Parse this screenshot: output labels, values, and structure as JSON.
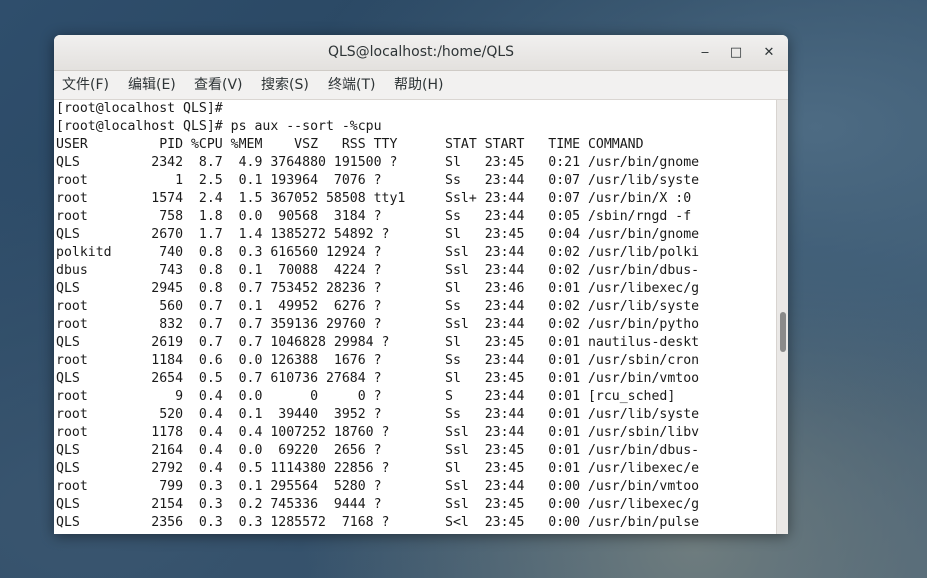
{
  "window": {
    "title": "QLS@localhost:/home/QLS",
    "controls": {
      "minimize": "‒",
      "maximize": "□",
      "close": "✕"
    }
  },
  "menu": [
    {
      "label": "文件(F)"
    },
    {
      "label": "编辑(E)"
    },
    {
      "label": "查看(V)"
    },
    {
      "label": "搜索(S)"
    },
    {
      "label": "终端(T)"
    },
    {
      "label": "帮助(H)"
    }
  ],
  "terminal": {
    "lines": [
      "[root@localhost QLS]#",
      "[root@localhost QLS]# ps aux --sort -%cpu",
      "USER         PID %CPU %MEM    VSZ   RSS TTY      STAT START   TIME COMMAND",
      "QLS         2342  8.7  4.9 3764880 191500 ?      Sl   23:45   0:21 /usr/bin/gnome",
      "root           1  2.5  0.1 193964  7076 ?        Ss   23:44   0:07 /usr/lib/syste",
      "root        1574  2.4  1.5 367052 58508 tty1     Ssl+ 23:44   0:07 /usr/bin/X :0",
      "root         758  1.8  0.0  90568  3184 ?        Ss   23:44   0:05 /sbin/rngd -f",
      "QLS         2670  1.7  1.4 1385272 54892 ?       Sl   23:45   0:04 /usr/bin/gnome",
      "polkitd      740  0.8  0.3 616560 12924 ?        Ssl  23:44   0:02 /usr/lib/polki",
      "dbus         743  0.8  0.1  70088  4224 ?        Ssl  23:44   0:02 /usr/bin/dbus-",
      "QLS         2945  0.8  0.7 753452 28236 ?        Sl   23:46   0:01 /usr/libexec/g",
      "root         560  0.7  0.1  49952  6276 ?        Ss   23:44   0:02 /usr/lib/syste",
      "root         832  0.7  0.7 359136 29760 ?        Ssl  23:44   0:02 /usr/bin/pytho",
      "QLS         2619  0.7  0.7 1046828 29984 ?       Sl   23:45   0:01 nautilus-deskt",
      "root        1184  0.6  0.0 126388  1676 ?        Ss   23:44   0:01 /usr/sbin/cron",
      "QLS         2654  0.5  0.7 610736 27684 ?        Sl   23:45   0:01 /usr/bin/vmtoo",
      "root           9  0.4  0.0      0     0 ?        S    23:44   0:01 [rcu_sched]",
      "root         520  0.4  0.1  39440  3952 ?        Ss   23:44   0:01 /usr/lib/syste",
      "root        1178  0.4  0.4 1007252 18760 ?       Ssl  23:44   0:01 /usr/sbin/libv",
      "QLS         2164  0.4  0.0  69220  2656 ?        Ssl  23:45   0:01 /usr/bin/dbus-",
      "QLS         2792  0.4  0.5 1114380 22856 ?       Sl   23:45   0:01 /usr/libexec/e",
      "root         799  0.3  0.1 295564  5280 ?        Ssl  23:44   0:00 /usr/bin/vmtoo",
      "QLS         2154  0.3  0.2 745336  9444 ?        Ssl  23:45   0:00 /usr/libexec/g",
      "QLS         2356  0.3  0.3 1285572  7168 ?       S<l  23:45   0:00 /usr/bin/pulse"
    ]
  }
}
